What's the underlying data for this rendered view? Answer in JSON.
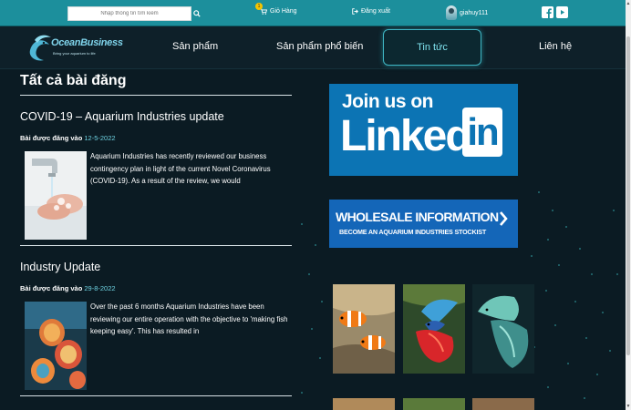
{
  "topbar": {
    "search_placeholder": "Nhập thông tin tìm kiếm",
    "cart_label": "Giỏ Hàng",
    "cart_count": "1",
    "logout_label": "Đăng xuất",
    "username": "giahuy111"
  },
  "logo": {
    "brand": "OceanBusiness",
    "tagline": "Bring your aquarium to life"
  },
  "nav": {
    "items": [
      {
        "label": "Sản phẩm"
      },
      {
        "label": "Sản phẩm phổ biến"
      },
      {
        "label": "Tin tức",
        "active": true
      },
      {
        "label": "Liên hệ"
      }
    ]
  },
  "main": {
    "page_title": "Tất cả bài đăng",
    "posts": [
      {
        "title": "COVID-19 – Aquarium Industries update",
        "meta_label": "Bài được đăng vào",
        "date": "12-5-2022",
        "excerpt": "Aquarium Industries has recently reviewed our business contingency plan in light of the current Novel Coronavirus (COVID-19). As a result of the review, we would"
      },
      {
        "title": "Industry Update",
        "meta_label": "Bài được đăng vào",
        "date": "29-8-2022",
        "excerpt": "Over the past 6 months Aquarium Industries have been reviewing our entire operation with the objective to 'making fish keeping easy'. This has resulted in"
      }
    ]
  },
  "sidebar": {
    "linkedin_ad": {
      "line1": "Join us on",
      "word": "Linked",
      "box": "in"
    },
    "wholesale_ad": {
      "title": "WHOLESALE INFORMATION",
      "subtitle": "BECOME AN AQUARIUM INDUSTRIES STOCKIST"
    }
  },
  "colors": {
    "topbar": "#1c8f9c",
    "background": "#0b1b23",
    "accent": "#7fe3ef",
    "date": "#6fd3e2",
    "linkedin_blue": "#0c74b4",
    "wholesale_blue": "#1466b8"
  },
  "icons": [
    "search-icon",
    "cart-icon",
    "logout-icon",
    "user-avatar",
    "facebook-icon",
    "youtube-icon",
    "chevron-right-icon"
  ]
}
